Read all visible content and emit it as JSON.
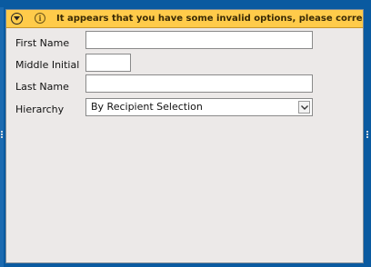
{
  "warning": {
    "message": "It appears that you have some invalid options, please correct the fol",
    "info_glyph": "i",
    "icons": [
      "chevron-down-circle-icon",
      "info-circle-icon"
    ],
    "color": "#ffcb4a"
  },
  "form": {
    "first_name": {
      "label": "First Name",
      "value": ""
    },
    "middle_initial": {
      "label": "Middle Initial",
      "value": ""
    },
    "last_name": {
      "label": "Last Name",
      "value": ""
    },
    "hierarchy": {
      "label": "Hierarchy",
      "selected": "By Recipient Selection"
    }
  },
  "colors": {
    "frame": "#0a5aa0",
    "panel": "#ece9e8",
    "warning_bg": "#ffcb4a"
  }
}
